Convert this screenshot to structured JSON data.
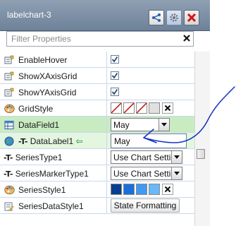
{
  "window": {
    "title": "labelchart-3"
  },
  "filter": {
    "placeholder": "Filter Properties",
    "value": ""
  },
  "properties": [
    {
      "name": "EnableHover",
      "icon": "property-icon",
      "type": "checkbox",
      "checked": true
    },
    {
      "name": "ShowXAxisGrid",
      "icon": "property-icon",
      "type": "checkbox",
      "checked": true
    },
    {
      "name": "ShowYAxisGrid",
      "icon": "property-icon",
      "type": "checkbox",
      "checked": true
    },
    {
      "name": "GridStyle",
      "icon": "palette-icon",
      "type": "style",
      "swatches": [
        "slash",
        "slash",
        "slash",
        "blank"
      ]
    },
    {
      "name": "DataField1",
      "icon": "table-icon",
      "type": "dropdown",
      "value": "May"
    },
    {
      "name": "DataLabel1",
      "icon": "globe-text-icon",
      "type": "text",
      "value": "May"
    },
    {
      "name": "SeriesType1",
      "icon": "text-type-icon",
      "type": "dropdown",
      "value": "Use Chart Setting"
    },
    {
      "name": "SeriesMarkerType1",
      "icon": "text-type-icon",
      "type": "dropdown",
      "value": "Use Chart Setting"
    },
    {
      "name": "SeriesStyle1",
      "icon": "palette-icon",
      "type": "style",
      "swatches": [
        "#0a3d8f",
        "#1a6fd8",
        "#3f9af0",
        "#6ab8f7"
      ]
    },
    {
      "name": "SeriesDataStyle1",
      "icon": "edit-list-icon",
      "type": "button",
      "value": "State Formatting"
    }
  ]
}
